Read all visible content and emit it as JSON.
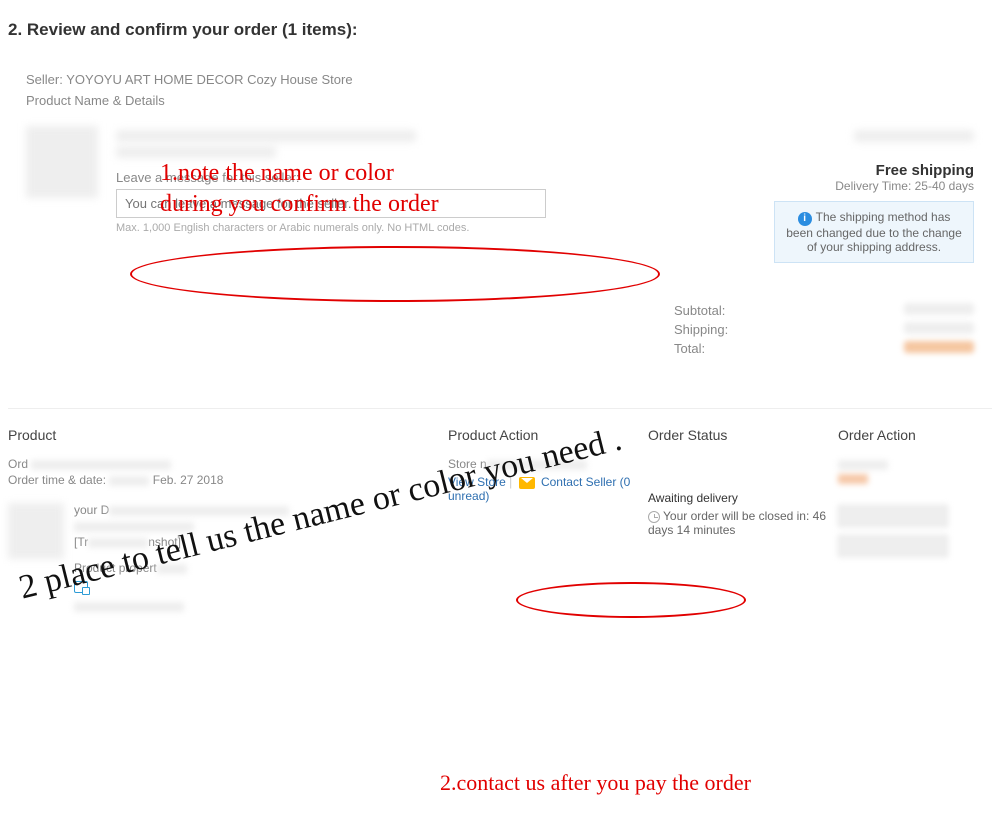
{
  "section_title": "2. Review and confirm your order (1 items):",
  "seller_prefix": "Seller: ",
  "seller_name": "YOYOYU ART HOME DECOR Cozy House Store",
  "product_name_details": "Product Name & Details",
  "shipping": {
    "free": "Free shipping",
    "delivery_label": "Delivery Time: ",
    "delivery_value": "25-40 days",
    "notice": "The shipping method has been changed due to the change of your shipping address."
  },
  "message": {
    "label": "Leave a message for this seller:",
    "placeholder": "You can leave a message for the seller.",
    "hint": "Max. 1,000 English characters or Arabic numerals only. No HTML codes."
  },
  "totals": {
    "subtotal": "Subtotal:",
    "shipping": "Shipping:",
    "total": "Total:"
  },
  "table": {
    "headers": {
      "product": "Product",
      "product_action": "Product Action",
      "order_status": "Order Status",
      "order_action": "Order Action"
    },
    "order_prefix": "Ord",
    "order_time_prefix": "Order time & date:",
    "order_date_suffix": "Feb. 27 2018",
    "store_prefix": "Store n",
    "view_store": "View Store",
    "contact_seller": "Contact Seller",
    "unread": "(0 unread)",
    "status": {
      "awaiting": "Awaiting delivery",
      "closed_prefix": "Your order will be closed in: ",
      "closed_value": "46 days 14 minutes"
    },
    "detail": {
      "line0": "your D",
      "snapshot_open": "[Tr",
      "snapshot_close": "nshot]",
      "propert": "Product propert"
    }
  },
  "annotations": {
    "a1_line1": "1.note the name or color",
    "a1_line2": "during you confirm the order",
    "a2": "2.contact us after you pay the order",
    "script": "2 place to tell us the name or color you need ."
  }
}
